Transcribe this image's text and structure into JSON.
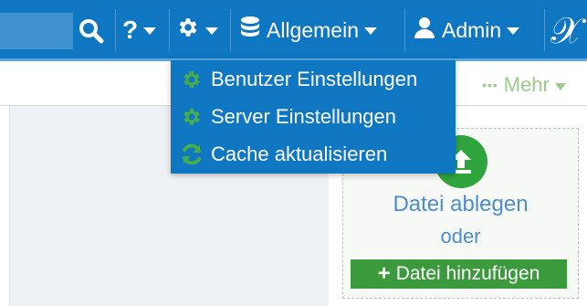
{
  "topbar": {
    "search": {
      "icon": "search-icon"
    },
    "help": {
      "label": "?"
    },
    "settings": {
      "icon": "gear-icon"
    },
    "database": {
      "label": "Allgemein",
      "icon": "database-icon"
    },
    "user": {
      "label": "Admin",
      "icon": "user-icon"
    },
    "logo": {
      "icon": "x-logo-icon"
    }
  },
  "subbar": {
    "more_label": "Mehr",
    "more_icon": "dots-icon"
  },
  "dropdown": {
    "items": [
      {
        "label": "Benutzer Einstellungen",
        "icon": "gear-icon"
      },
      {
        "label": "Server Einstellungen",
        "icon": "gear-icon"
      },
      {
        "label": "Cache aktualisieren",
        "icon": "refresh-icon"
      }
    ]
  },
  "upload": {
    "drop_label": "Datei ablegen",
    "or_label": "oder",
    "add_button_label": "Datei hinzufügen",
    "icon": "upload-icon"
  },
  "colors": {
    "topbar": "#0f76c2",
    "menu_icon_green": "#47ad4a",
    "button_green": "#3b9b3c",
    "link_blue": "#4e8dc8"
  }
}
